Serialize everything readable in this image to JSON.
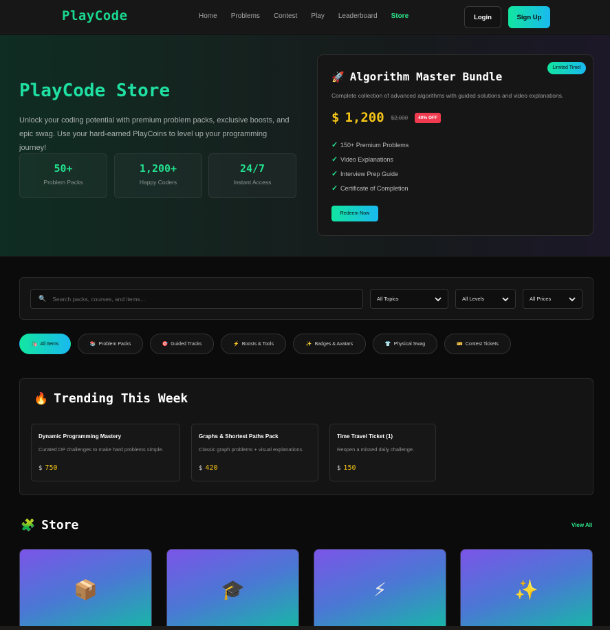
{
  "nav": {
    "logo": "PlayCode",
    "links": [
      "Home",
      "Problems",
      "Contest",
      "Play",
      "Leaderboard",
      "Store"
    ],
    "active_link": "Store",
    "login": "Login",
    "signup": "Sign Up"
  },
  "hero": {
    "title": "PlayCode Store",
    "description": "Unlock your coding potential with premium problem packs, exclusive boosts, and epic swag. Use your hard-earned PlayCoins to level up your programming journey!",
    "stats": [
      {
        "value": "50+",
        "label": "Problem Packs"
      },
      {
        "value": "1,200+",
        "label": "Happy Coders"
      },
      {
        "value": "24/7",
        "label": "Instant Access"
      }
    ]
  },
  "bundle": {
    "badge": "Limited Time!",
    "icon": "rocket-icon",
    "title": "Algorithm Master Bundle",
    "description": "Complete collection of advanced algorithms with guided solutions and video explanations.",
    "currency_symbol": "$",
    "price": "1,200",
    "old_price": "$2,000",
    "discount": "40% OFF",
    "features": [
      "150+ Premium Problems",
      "Video Explanations",
      "Interview Prep Guide",
      "Certificate of Completion"
    ],
    "cta": "Redeem Now"
  },
  "filters": {
    "search_placeholder": "Search packs, courses, and items...",
    "topics": "All Topics",
    "levels": "All Levels",
    "prices": "All Prices"
  },
  "chips": [
    {
      "icon": "🛍️",
      "label": "All Items"
    },
    {
      "icon": "📚",
      "label": "Problem Packs"
    },
    {
      "icon": "🎯",
      "label": "Guided Tracks"
    },
    {
      "icon": "⚡",
      "label": "Boosts & Tools"
    },
    {
      "icon": "✨",
      "label": "Badges & Avatars"
    },
    {
      "icon": "👕",
      "label": "Physical Swag"
    },
    {
      "icon": "🎫",
      "label": "Contest Tickets"
    }
  ],
  "trending": {
    "title": "Trending This Week",
    "icon": "fire-icon",
    "items": [
      {
        "title": "Dynamic Programming Mastery",
        "description": "Curated DP challenges to make hard problems simple.",
        "currency": "$",
        "price": "750"
      },
      {
        "title": "Graphs & Shortest Paths Pack",
        "description": "Classic graph problems + visual explanations.",
        "currency": "$",
        "price": "420"
      },
      {
        "title": "Time Travel Ticket (1)",
        "description": "Reopen a missed daily challenge.",
        "currency": "$",
        "price": "150"
      }
    ]
  },
  "store": {
    "title": "Store",
    "icon": "puzzle-icon",
    "view_all": "View All",
    "cards": [
      {
        "icon": "📦",
        "icon_name": "package-icon"
      },
      {
        "icon": "🎓",
        "icon_name": "graduation-cap-icon"
      },
      {
        "icon": "⚡",
        "icon_name": "lightning-icon"
      },
      {
        "icon": "✨",
        "icon_name": "sparkles-icon"
      }
    ]
  },
  "colors": {
    "accent": "#19d98f",
    "gold": "#f5c518",
    "discount": "#ef3a4f"
  }
}
